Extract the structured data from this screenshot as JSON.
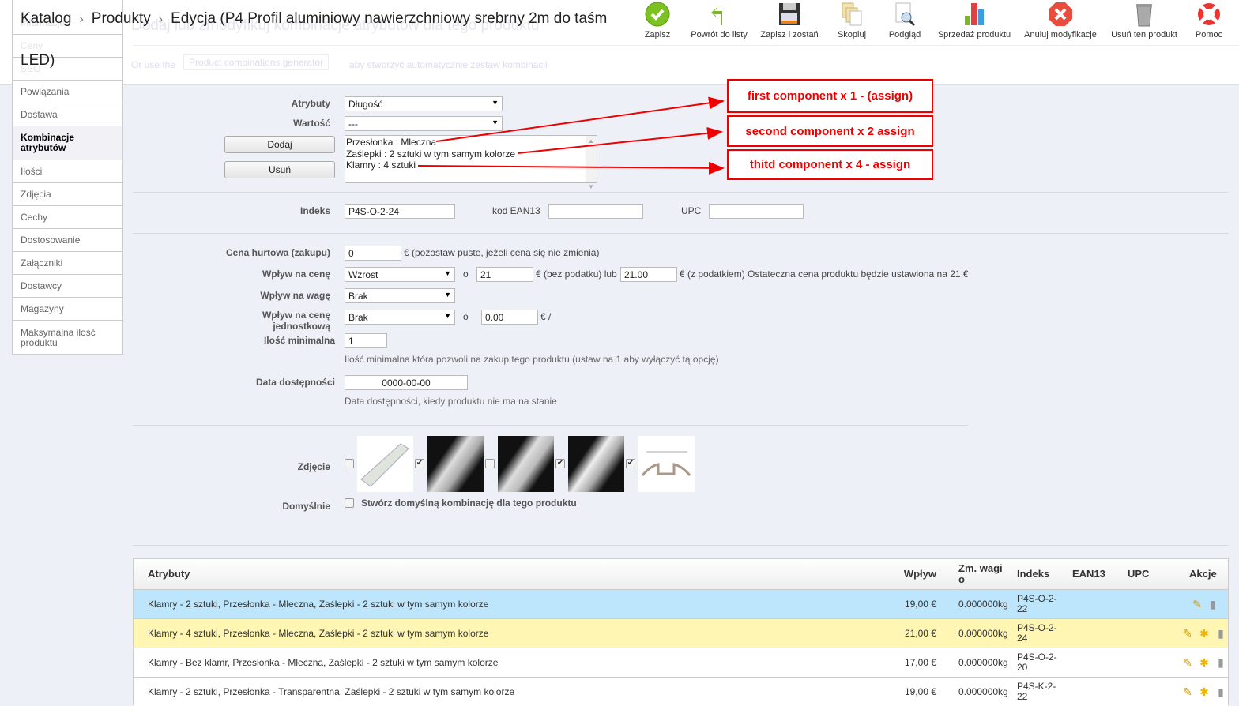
{
  "header": {
    "breadcrumb": [
      "Katalog",
      "Produkty",
      "Edycja (P4 Profil aluminiowy nawierzchniowy srebrny 2m do taśm",
      "LED)"
    ],
    "faded_title": "Dodaj lub zmodyfikuj kombinacje atrybutów dla tego produktu",
    "faded_or": "Or use the",
    "faded_generator": "Product combinations generator",
    "faded_auto": "aby stworzyć automatycznie zestaw kombinacji"
  },
  "toolbar": [
    {
      "label": "Zapisz",
      "icon": "save-check-icon"
    },
    {
      "label": "Powrót do listy",
      "icon": "back-arrow-icon"
    },
    {
      "label": "Zapisz i zostań",
      "icon": "floppy-disk-icon"
    },
    {
      "label": "Skopiuj",
      "icon": "copy-icon"
    },
    {
      "label": "Podgląd",
      "icon": "preview-icon"
    },
    {
      "label": "Sprzedaż produktu",
      "icon": "bar-chart-icon"
    },
    {
      "label": "Anuluj modyfikacje",
      "icon": "cancel-icon"
    },
    {
      "label": "Usuń ten produkt",
      "icon": "trash-icon"
    },
    {
      "label": "Pomoc",
      "icon": "lifebuoy-icon"
    }
  ],
  "sidebar": {
    "faded": [
      "Informacje",
      "Ceny",
      "SEO"
    ],
    "items": [
      "Powiązania",
      "Dostawa",
      "Kombinacje atrybutów",
      "Ilości",
      "Zdjęcia",
      "Cechy",
      "Dostosowanie",
      "Załączniki",
      "Dostawcy",
      "Magazyny",
      "Maksymalna ilość produktu"
    ]
  },
  "form": {
    "attr_label": "Atrybuty",
    "attr_value": "Długość",
    "value_label": "Wartość",
    "value_value": "---",
    "add_button": "Dodaj",
    "remove_button": "Usuń",
    "selected": [
      "Przesłonka : Mleczna",
      "Zaślepki : 2 sztuki w tym samym kolorze",
      "Klamry : 4 sztuki"
    ],
    "index_label": "Indeks",
    "index_value": "P4S-O-2-24",
    "ean_label": "kod EAN13",
    "ean_value": "",
    "upc_label": "UPC",
    "upc_value": "",
    "wholesale_label": "Cena hurtowa (zakupu)",
    "wholesale_value": "0",
    "wholesale_note": "€ (pozostaw puste, jeżeli cena się nie zmienia)",
    "price_impact_label": "Wpływ na cenę",
    "price_impact": "Wzrost",
    "o": "o",
    "price_net": "21",
    "price_net_note": "€ (bez podatku) lub",
    "price_gross": "21.00",
    "price_gross_note": "€ (z podatkiem) Ostateczna cena produktu będzie ustawiona na 21 €",
    "weight_label": "Wpływ na wagę",
    "weight_impact": "Brak",
    "unit_label": "Wpływ na cenę jednostkową",
    "unit_impact": "Brak",
    "unit_value": "0.00",
    "unit_note": "€ /",
    "minqty_label": "Ilość minimalna",
    "minqty_value": "1",
    "minqty_note": "Ilość minimalna która pozwoli na zakup tego produktu (ustaw na 1 aby wyłączyć tą opcję)",
    "date_label": "Data dostępności",
    "date_value": "0000-00-00",
    "date_note": "Data dostępności, kiedy produktu nie ma na stanie",
    "photo_label": "Zdjęcie",
    "photos_checked": [
      false,
      true,
      false,
      true,
      true
    ],
    "default_label": "Domyślnie",
    "default_text": "Stwórz domyślną kombinację dla tego produktu"
  },
  "annotations": [
    "first component x 1 - (assign)",
    "second component x 2 assign",
    "thitd component x 4 - assign"
  ],
  "annotation_color": "#e00000",
  "table": {
    "headers": [
      "Atrybuty",
      "Wpływ",
      "Zm. wagi o",
      "Indeks",
      "EAN13",
      "UPC",
      "Akcje"
    ],
    "rows": [
      {
        "attrs": "Klamry - 2 sztuki, Przesłonka - Mleczna, Zaślepki - 2 sztuki w tym samym kolorze",
        "impact": "19,00 €",
        "weight": "0.000000kg",
        "index": "P4S-O-2-22",
        "ean": "",
        "upc": "",
        "bg": "#bde5fb"
      },
      {
        "attrs": "Klamry - 4 sztuki, Przesłonka - Mleczna, Zaślepki - 2 sztuki w tym samym kolorze",
        "impact": "21,00 €",
        "weight": "0.000000kg",
        "index": "P4S-O-2-24",
        "ean": "",
        "upc": "",
        "bg": "#fff6b4"
      },
      {
        "attrs": "Klamry - Bez klamr, Przesłonka - Mleczna, Zaślepki - 2 sztuki w tym samym kolorze",
        "impact": "17,00 €",
        "weight": "0.000000kg",
        "index": "P4S-O-2-20",
        "ean": "",
        "upc": "",
        "bg": "#ffffff"
      },
      {
        "attrs": "Klamry - 2 sztuki, Przesłonka - Transparentna, Zaślepki - 2 sztuki w tym samym kolorze",
        "impact": "19,00 €",
        "weight": "0.000000kg",
        "index": "P4S-K-2-22",
        "ean": "",
        "upc": "",
        "bg": "#ffffff"
      }
    ]
  }
}
